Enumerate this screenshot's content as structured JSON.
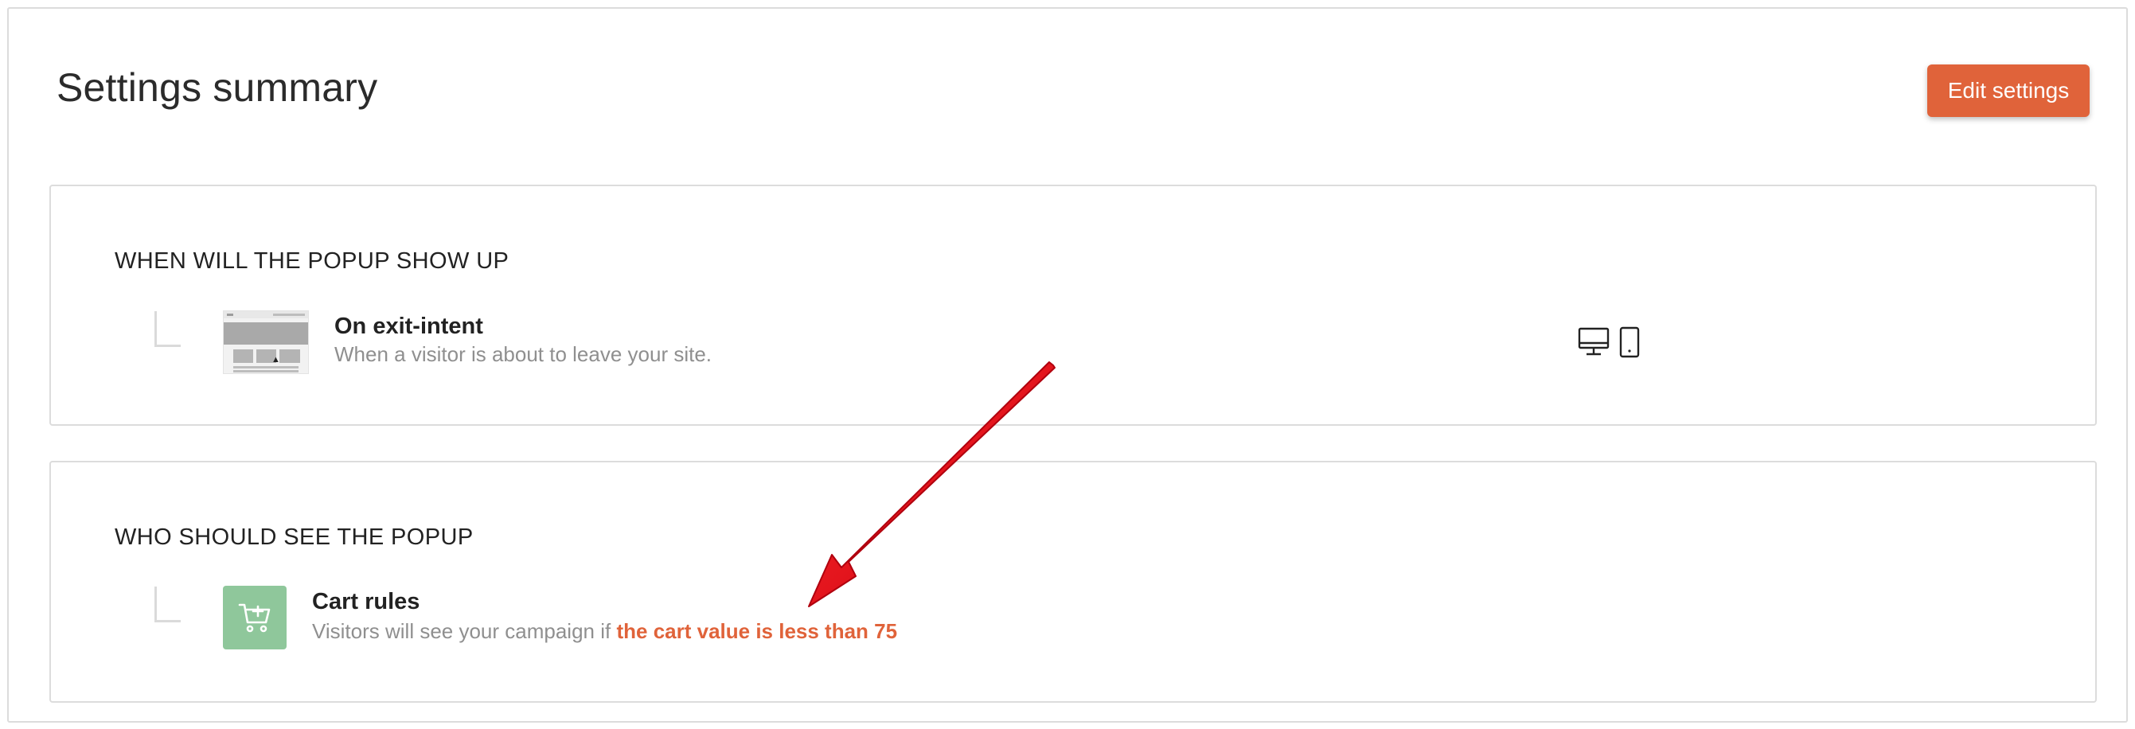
{
  "header": {
    "title": "Settings summary",
    "edit_label": "Edit settings"
  },
  "when": {
    "heading": "WHEN WILL THE POPUP SHOW UP",
    "trigger_title": "On exit-intent",
    "trigger_desc": "When a visitor is about to leave your site.",
    "devices": [
      "desktop-icon",
      "mobile-icon"
    ]
  },
  "who": {
    "heading": "WHO SHOULD SEE THE POPUP",
    "rule_title": "Cart rules",
    "rule_desc_prefix": "Visitors will see your campaign if",
    "rule_condition": "the cart value is less than 75"
  },
  "colors": {
    "accent": "#e0633a",
    "cart_icon_bg": "#8fc79b",
    "annotation_arrow": "#e30613"
  }
}
